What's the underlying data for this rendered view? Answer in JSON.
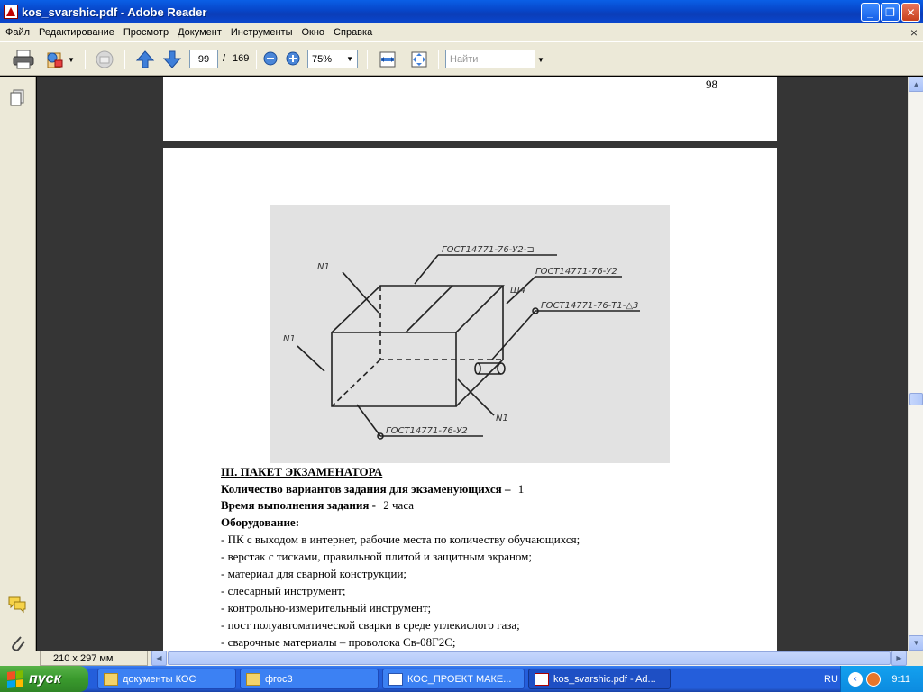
{
  "window": {
    "title": "kos_svarshic.pdf - Adobe Reader",
    "minimize_label": "_",
    "maximize_label": "❐",
    "close_label": "✕"
  },
  "menu": {
    "items": [
      "Файл",
      "Редактирование",
      "Просмотр",
      "Документ",
      "Инструменты",
      "Окно",
      "Справка"
    ],
    "close_glyph": "×"
  },
  "toolbar": {
    "page_current": "99",
    "page_separator": "/",
    "page_total": "169",
    "zoom_value": "75%",
    "search_placeholder": "Найти"
  },
  "document": {
    "page_number": "98",
    "figure_labels": {
      "top_left_n1": "N1",
      "left_n1": "N1",
      "bottom_right_n1": "N1",
      "top_standard": "ГОСТ14771-76-У2-⊐",
      "right_standard": "ГОСТ14771-76-У2",
      "right_mark": "Ш4",
      "right_lower_standard": "ГОСТ14771-76-Т1-△3",
      "bottom_standard": "ГОСТ14771-76-У2"
    },
    "section_title": "III. ПАКЕТ ЭКЗАМЕНАТОРА",
    "variants_label": "Количество вариантов задания для экзаменующихся –",
    "variants_value": "1",
    "time_label": "Время выполнения задания -",
    "time_value": "2 часа",
    "equipment_label": "Оборудование:",
    "equipment_items": [
      "- ПК с выходом в интернет, рабочие места по количеству обучающихся;",
      "- верстак с тисками, правильной плитой и защитным экраном;",
      "- материал для сварной конструкции;",
      "- слесарный инструмент;",
      "- контрольно-измерительный инструмент;",
      "- пост полуавтоматической сварки в среде углекислого газа;",
      "- сварочные материалы – проволока Св-08Г2С;"
    ]
  },
  "status": {
    "page_size": "210 x 297 мм"
  },
  "taskbar": {
    "start_label": "пуск",
    "tasks": [
      "документы КОС",
      "фгос3",
      "КОС_ПРОЕКТ МАКЕ...",
      "kos_svarshic.pdf - Ad..."
    ],
    "language": "RU",
    "clock": "9:11"
  },
  "colors": {
    "titlebar": "#0745c8",
    "chrome": "#ece9d8",
    "doc_background": "#353535",
    "taskbar": "#245edb",
    "start_button": "#3a9a2d"
  }
}
